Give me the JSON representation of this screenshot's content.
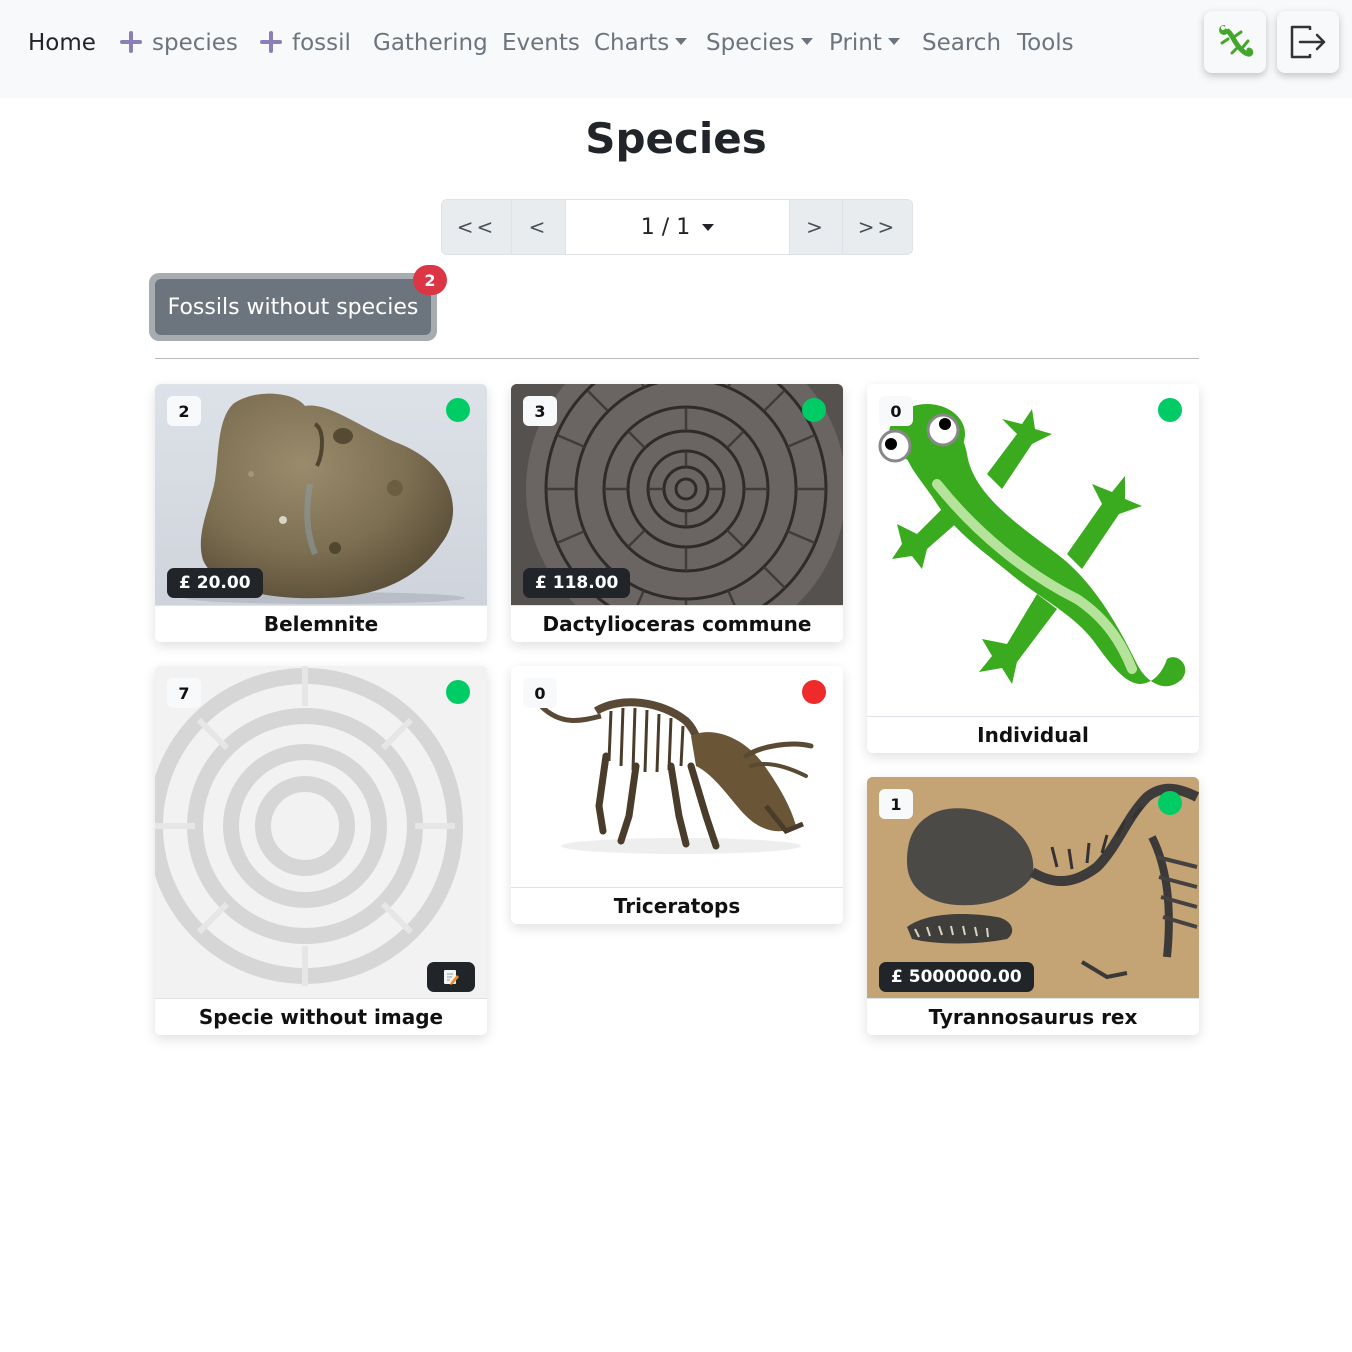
{
  "nav": {
    "home": "Home",
    "add_species": "species",
    "add_fossil": "fossil",
    "gathering": "Gathering",
    "events": "Events",
    "charts": "Charts",
    "species_menu": "Species",
    "print": "Print",
    "search": "Search",
    "tools": "Tools",
    "icons": [
      "lizard-icon",
      "logout-icon"
    ]
  },
  "page": {
    "title": "Species"
  },
  "pagination": {
    "first": "<<",
    "prev": "<",
    "current": "1 / 1",
    "next": ">",
    "last": ">>"
  },
  "fossils_without_species": {
    "label": "Fossils without species",
    "count": "2"
  },
  "colors": {
    "status_ok": "#00cc66",
    "status_bad": "#ee2a2a",
    "badge_red": "#dc3545",
    "nav_plus": "#8c7fb8"
  },
  "cards": [
    {
      "name": "Belemnite",
      "count": "2",
      "price": "£ 20.00",
      "status": "green"
    },
    {
      "name": "Dactylioceras commune",
      "count": "3",
      "price": "£ 118.00",
      "status": "green"
    },
    {
      "name": "Individual",
      "count": "0",
      "status": "green"
    },
    {
      "name": "Specie without image",
      "count": "7",
      "status": "green"
    },
    {
      "name": "Triceratops",
      "count": "0",
      "status": "red"
    },
    {
      "name": "Tyrannosaurus rex",
      "count": "1",
      "price": "£ 5000000.00",
      "status": "green"
    }
  ]
}
